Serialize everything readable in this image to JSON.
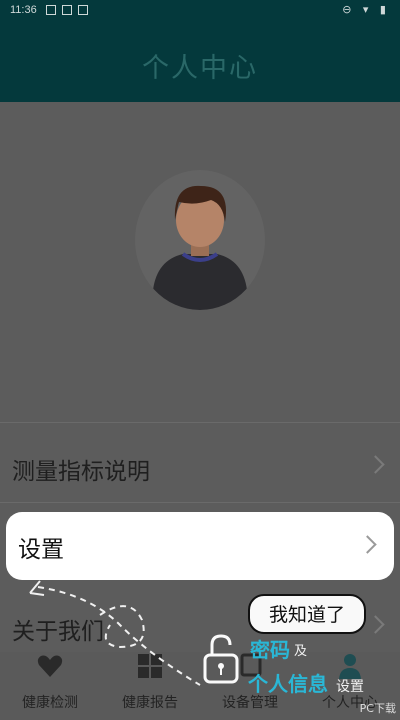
{
  "status_bar": {
    "time": "11:36",
    "right_icons": [
      "minus-circle-icon",
      "wifi-icon",
      "battery-icon"
    ]
  },
  "header": {
    "title": "个人中心"
  },
  "menu": {
    "items": [
      {
        "label": "测量指标说明"
      },
      {
        "label": "设置"
      },
      {
        "label": "关于我们"
      }
    ]
  },
  "tabbar": {
    "tabs": [
      {
        "label": "健康检测",
        "icon": "heart-icon"
      },
      {
        "label": "健康报告",
        "icon": "grid-icon"
      },
      {
        "label": "设备管理",
        "icon": "device-icon"
      },
      {
        "label": "个人中心",
        "icon": "person-icon"
      }
    ]
  },
  "guide": {
    "button_label": "我知道了",
    "password_text": "密码",
    "and_text": "及",
    "info_text": "个人信息",
    "settings_text": "设置"
  },
  "watermark": "PC下载",
  "colors": {
    "header_bg": "#04393c",
    "accent": "#2ab7d6",
    "overlay": "#5a5a5a"
  }
}
